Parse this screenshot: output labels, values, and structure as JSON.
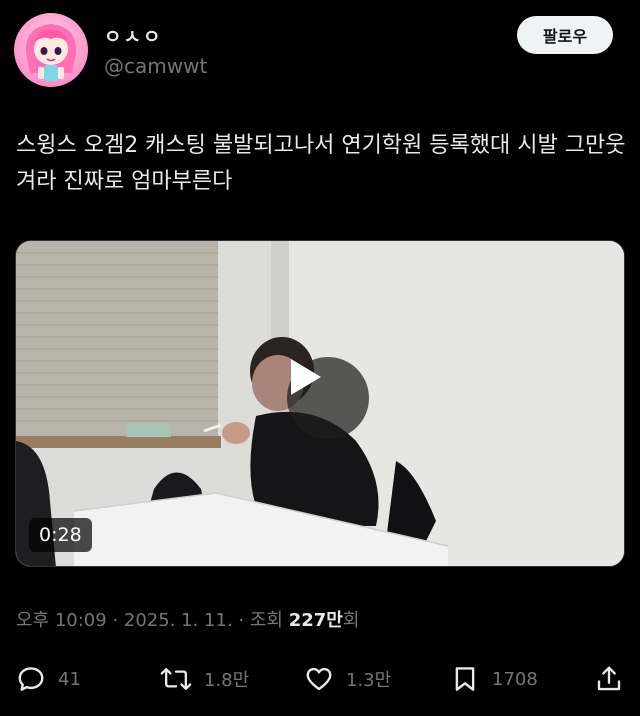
{
  "author": {
    "display_name": "ㅇㅅㅇ",
    "handle": "@camwwt",
    "avatar_icon": "anime-girl-avatar"
  },
  "follow_button": {
    "label": "팔로우"
  },
  "tweet": {
    "text": "스윙스 오겜2 캐스팅 불발되고나서 연기학원 등록했대 시발 그만웃겨라 진짜로 엄마부른다"
  },
  "video": {
    "duration": "0:28",
    "play_icon": "play-icon"
  },
  "meta": {
    "time": "오후 10:09",
    "date": "2025. 1. 11.",
    "views_label": "조회",
    "views_count": "227만",
    "views_suffix": "회",
    "separator": " · "
  },
  "actions": {
    "reply": {
      "icon": "reply-icon",
      "count": "41"
    },
    "retweet": {
      "icon": "retweet-icon",
      "count": "1.8만"
    },
    "like": {
      "icon": "heart-icon",
      "count": "1.3만"
    },
    "bookmark": {
      "icon": "bookmark-icon",
      "count": "1708"
    },
    "share": {
      "icon": "share-icon"
    }
  },
  "colors": {
    "background": "#000000",
    "text_primary": "#e7e9ea",
    "text_secondary": "#71767b",
    "follow_button_bg": "#eff3f4"
  }
}
